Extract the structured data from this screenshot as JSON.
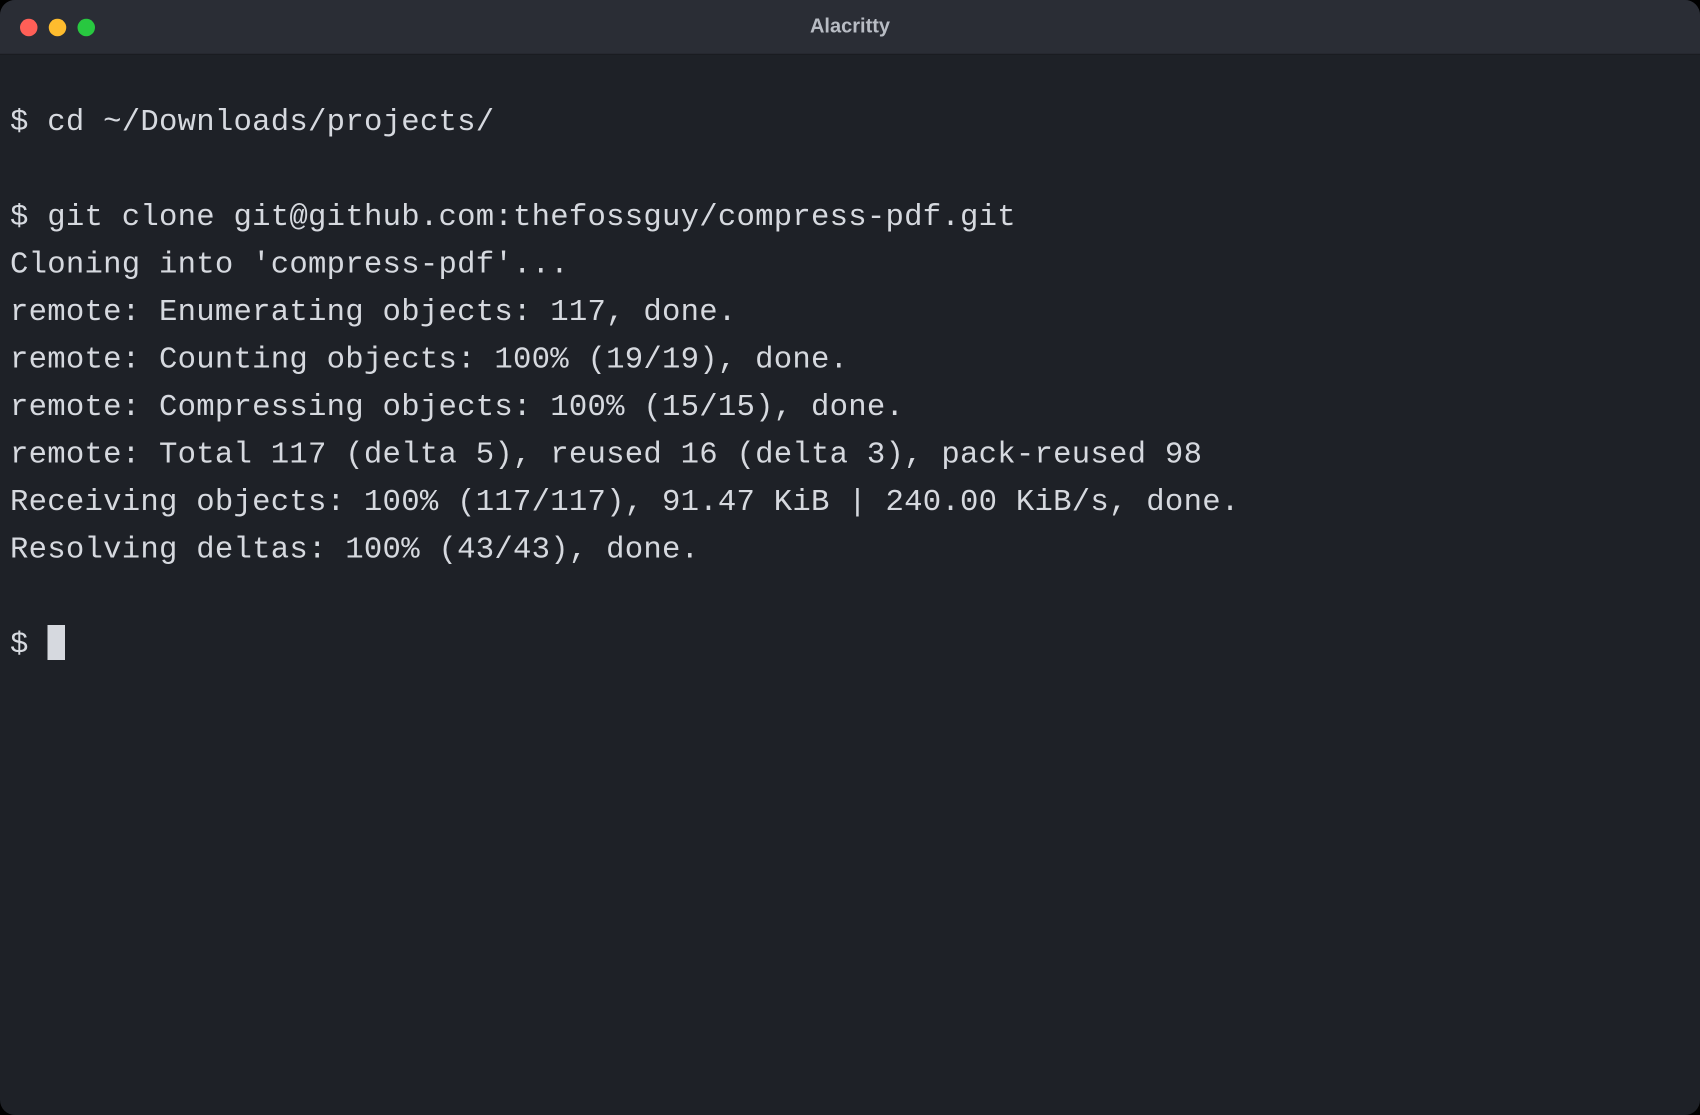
{
  "window": {
    "title": "Alacritty"
  },
  "terminal": {
    "prompt": "$ ",
    "lines": [
      {
        "type": "cmd",
        "text": "cd ~/Downloads/projects/"
      },
      {
        "type": "blank",
        "text": ""
      },
      {
        "type": "cmd",
        "text": "git clone git@github.com:thefossguy/compress-pdf.git"
      },
      {
        "type": "out",
        "text": "Cloning into 'compress-pdf'..."
      },
      {
        "type": "out",
        "text": "remote: Enumerating objects: 117, done."
      },
      {
        "type": "out",
        "text": "remote: Counting objects: 100% (19/19), done."
      },
      {
        "type": "out",
        "text": "remote: Compressing objects: 100% (15/15), done."
      },
      {
        "type": "out",
        "text": "remote: Total 117 (delta 5), reused 16 (delta 3), pack-reused 98"
      },
      {
        "type": "out",
        "text": "Receiving objects: 100% (117/117), 91.47 KiB | 240.00 KiB/s, done."
      },
      {
        "type": "out",
        "text": "Resolving deltas: 100% (43/43), done."
      },
      {
        "type": "blank",
        "text": ""
      },
      {
        "type": "prompt",
        "text": ""
      }
    ]
  }
}
